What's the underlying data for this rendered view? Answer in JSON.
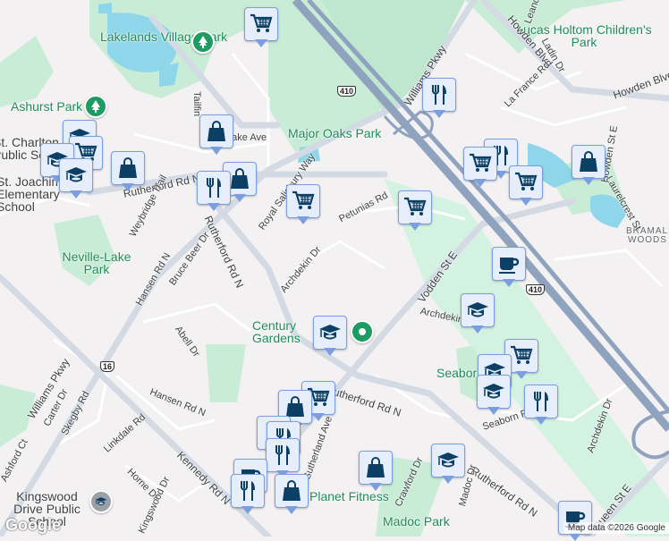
{
  "parks": [
    "Lakelands Village Park",
    "Ashurst Park",
    "Major Oaks Park",
    "Lucas Holtom Children's Park",
    "Neville-Lake Park",
    "Century Gardens Recreation",
    "Seaborn",
    "Madoc Park",
    "Planet Fitness"
  ],
  "places": {
    "woods": "BRAMALEA WOODS",
    "school1": "St. Charlton Public School",
    "school2": "St. Joachim Elementary School",
    "school3": "Kingswood Drive Public School"
  },
  "streets": {
    "rutherford": "Rutherford Rd N",
    "williams": "Williams Pkwy",
    "kennedy": "Kennedy Rd N",
    "vodden": "Vodden St E",
    "queen": "Queen St E",
    "howden": "Howden Blvd",
    "hansen": "Hansen Rd N",
    "archdekin": "Archdekin Dr",
    "petunias": "Petunias Rd",
    "lafrance": "La France Rd",
    "laurelcrest": "Laurelcrest St",
    "weybridge": "Weybridge Trail",
    "bruce": "Bruce Beer Dr",
    "abell": "Abell Dr",
    "carter": "Carter Dr",
    "skegby": "Skegby Rd",
    "linkdale": "Linkdale Rd",
    "horne": "Horne Dr",
    "ashford": "Ashford Ct",
    "crawford": "Crawford Dr",
    "madoc": "Madoc Dr",
    "sutherland": "Sutherland Ave",
    "seaborn": "Seaborn Rd",
    "tailfin": "Tailfin",
    "royalsal": "Royal Salisbury Way",
    "ladin": "Ladin Dr",
    "leander": "Leander St",
    "kingswood": "Kingswood Dr",
    "sandlake": "Sandlake Ave",
    "howdenst": "Howden St E"
  },
  "shields": {
    "hwy410": "410",
    "hwy16": "16"
  },
  "map": {
    "logo": "Google",
    "attribution": "Map data ©2026 Google"
  },
  "colors": {
    "marker_fill": "#e6eefc",
    "marker_border": "#7b9ee0",
    "icon": "#0b3f63",
    "park_green": "#c8ecd6",
    "water": "#8fd6ea",
    "highway": "#8fa3bf"
  }
}
